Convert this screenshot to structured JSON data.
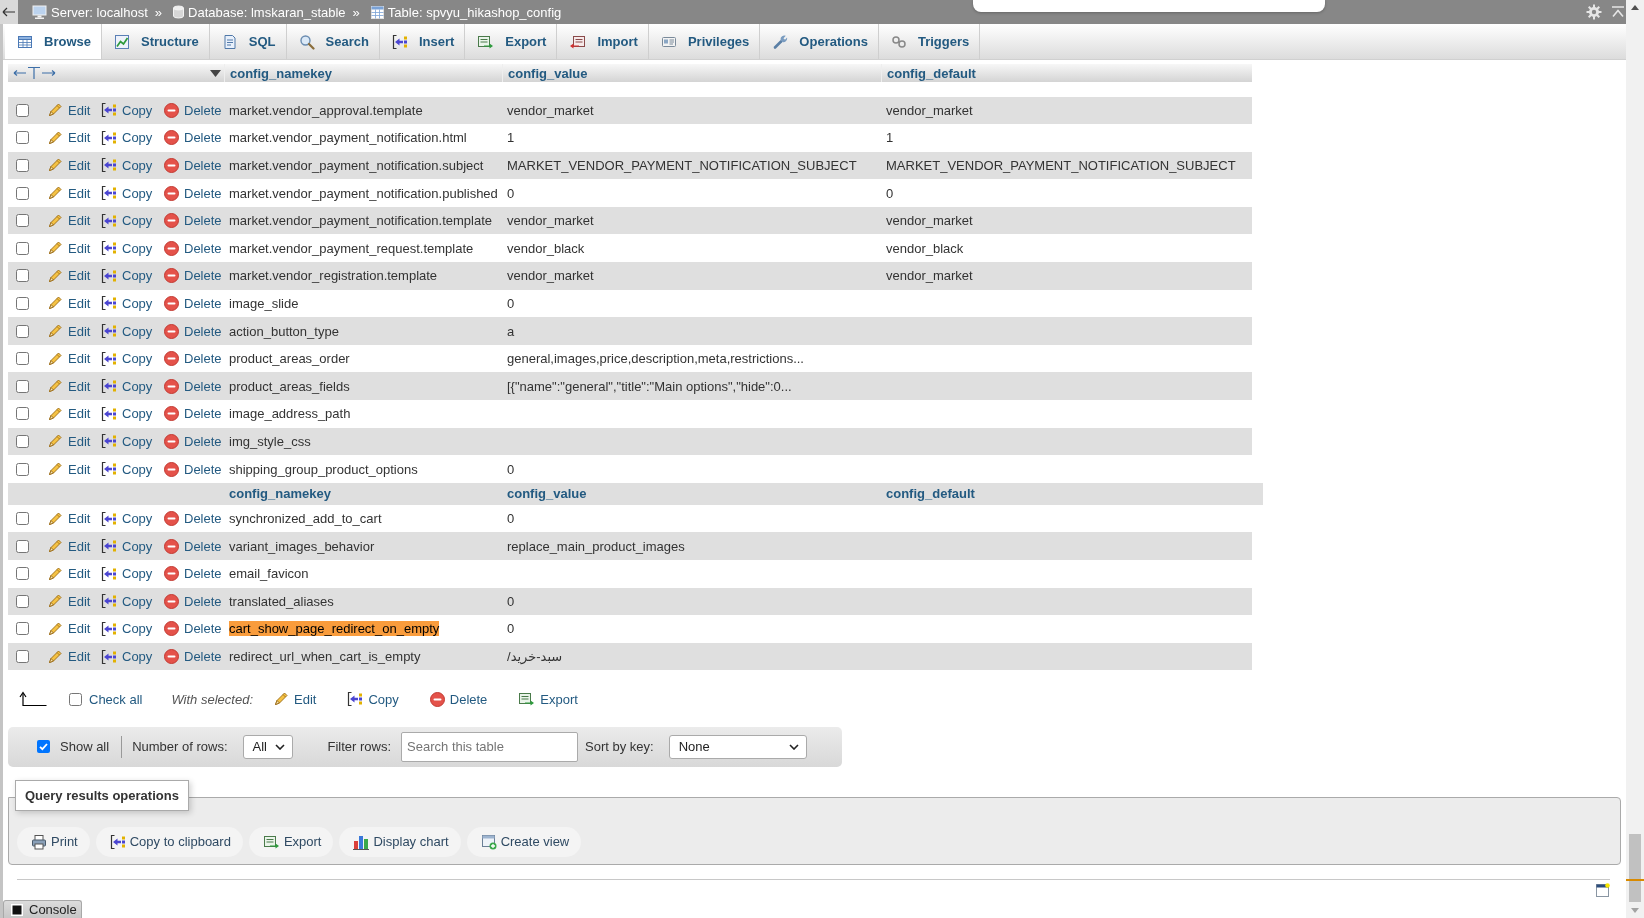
{
  "top_bar": {
    "breadcrumbs": [
      {
        "kind": "server",
        "label": "Server: localhost"
      },
      {
        "kind": "separator",
        "label": "»"
      },
      {
        "kind": "database",
        "label": "Database: lmskaran_stable"
      },
      {
        "kind": "separator",
        "label": "»"
      },
      {
        "kind": "table",
        "label": "Table: spvyu_hikashop_config"
      }
    ]
  },
  "tabs": [
    {
      "kind": "browse",
      "label": "Browse",
      "selected": true
    },
    {
      "kind": "structure",
      "label": "Structure",
      "selected": false
    },
    {
      "kind": "sql",
      "label": "SQL",
      "selected": false
    },
    {
      "kind": "search",
      "label": "Search",
      "selected": false
    },
    {
      "kind": "insert",
      "label": "Insert",
      "selected": false
    },
    {
      "kind": "export",
      "label": "Export",
      "selected": false
    },
    {
      "kind": "import",
      "label": "Import",
      "selected": false
    },
    {
      "kind": "privileges",
      "label": "Privileges",
      "selected": false
    },
    {
      "kind": "operations",
      "label": "Operations",
      "selected": false
    },
    {
      "kind": "triggers",
      "label": "Triggers",
      "selected": false
    }
  ],
  "table": {
    "rows": [
      {
        "kind": "sticky_header",
        "columns": [
          "config_namekey",
          "config_value",
          "config_default"
        ]
      },
      {
        "kind": "data",
        "checked": false,
        "edit": "Edit",
        "copy": "Copy",
        "delete": "Delete",
        "config_namekey": "market.vendor_approval.template",
        "highlighted": false,
        "config_value": "vendor_market",
        "config_default": "vendor_market"
      },
      {
        "kind": "data",
        "checked": false,
        "edit": "Edit",
        "copy": "Copy",
        "delete": "Delete",
        "config_namekey": "market.vendor_payment_notification.html",
        "highlighted": false,
        "config_value": "1",
        "config_default": "1"
      },
      {
        "kind": "data",
        "checked": false,
        "edit": "Edit",
        "copy": "Copy",
        "delete": "Delete",
        "config_namekey": "market.vendor_payment_notification.subject",
        "highlighted": false,
        "config_value": "MARKET_VENDOR_PAYMENT_NOTIFICATION_SUBJECT",
        "config_default": "MARKET_VENDOR_PAYMENT_NOTIFICATION_SUBJECT"
      },
      {
        "kind": "data",
        "checked": false,
        "edit": "Edit",
        "copy": "Copy",
        "delete": "Delete",
        "config_namekey": "market.vendor_payment_notification.published",
        "highlighted": false,
        "config_value": "0",
        "config_default": "0"
      },
      {
        "kind": "data",
        "checked": false,
        "edit": "Edit",
        "copy": "Copy",
        "delete": "Delete",
        "config_namekey": "market.vendor_payment_notification.template",
        "highlighted": false,
        "config_value": "vendor_market",
        "config_default": "vendor_market"
      },
      {
        "kind": "data",
        "checked": false,
        "edit": "Edit",
        "copy": "Copy",
        "delete": "Delete",
        "config_namekey": "market.vendor_payment_request.template",
        "highlighted": false,
        "config_value": "vendor_black",
        "config_default": "vendor_black"
      },
      {
        "kind": "data",
        "checked": false,
        "edit": "Edit",
        "copy": "Copy",
        "delete": "Delete",
        "config_namekey": "market.vendor_registration.template",
        "highlighted": false,
        "config_value": "vendor_market",
        "config_default": "vendor_market"
      },
      {
        "kind": "data",
        "checked": false,
        "edit": "Edit",
        "copy": "Copy",
        "delete": "Delete",
        "config_namekey": "image_slide",
        "highlighted": false,
        "config_value": "0"
      },
      {
        "kind": "data",
        "checked": false,
        "edit": "Edit",
        "copy": "Copy",
        "delete": "Delete",
        "config_namekey": "action_button_type",
        "highlighted": false,
        "config_value": "a"
      },
      {
        "kind": "data",
        "checked": false,
        "edit": "Edit",
        "copy": "Copy",
        "delete": "Delete",
        "config_namekey": "product_areas_order",
        "highlighted": false,
        "config_value": "general,images,price,description,meta,restrictions..."
      },
      {
        "kind": "data",
        "checked": false,
        "edit": "Edit",
        "copy": "Copy",
        "delete": "Delete",
        "config_namekey": "product_areas_fields",
        "highlighted": false,
        "config_value": "[{\"name\":\"general\",\"title\":\"Main options\",\"hide\":0..."
      },
      {
        "kind": "data",
        "checked": false,
        "edit": "Edit",
        "copy": "Copy",
        "delete": "Delete",
        "config_namekey": "image_address_path",
        "highlighted": false
      },
      {
        "kind": "data",
        "checked": false,
        "edit": "Edit",
        "copy": "Copy",
        "delete": "Delete",
        "config_namekey": "img_style_css",
        "highlighted": false
      },
      {
        "kind": "data",
        "checked": false,
        "edit": "Edit",
        "copy": "Copy",
        "delete": "Delete",
        "config_namekey": "shipping_group_product_options",
        "highlighted": false,
        "config_value": "0"
      },
      {
        "kind": "header",
        "columns": [
          "config_namekey",
          "config_value",
          "config_default"
        ]
      },
      {
        "kind": "data",
        "checked": false,
        "edit": "Edit",
        "copy": "Copy",
        "delete": "Delete",
        "config_namekey": "synchronized_add_to_cart",
        "highlighted": false,
        "config_value": "0"
      },
      {
        "kind": "data",
        "checked": false,
        "edit": "Edit",
        "copy": "Copy",
        "delete": "Delete",
        "config_namekey": "variant_images_behavior",
        "highlighted": false,
        "config_value": "replace_main_product_images"
      },
      {
        "kind": "data",
        "checked": false,
        "edit": "Edit",
        "copy": "Copy",
        "delete": "Delete",
        "config_namekey": "email_favicon",
        "highlighted": false
      },
      {
        "kind": "data",
        "checked": false,
        "edit": "Edit",
        "copy": "Copy",
        "delete": "Delete",
        "config_namekey": "translated_aliases",
        "highlighted": false,
        "config_value": "0"
      },
      {
        "kind": "data",
        "checked": false,
        "edit": "Edit",
        "copy": "Copy",
        "delete": "Delete",
        "config_namekey": "cart_show_page_redirect_on_empty",
        "highlighted": true,
        "config_value": "0"
      },
      {
        "kind": "data",
        "checked": false,
        "edit": "Edit",
        "copy": "Copy",
        "delete": "Delete",
        "config_namekey": "redirect_url_when_cart_is_empty",
        "highlighted": false,
        "config_value": "/سبد-خرید"
      }
    ]
  },
  "bulk_actions": {
    "check_all": {
      "label": "Check all",
      "checked": false
    },
    "with_selected": "With selected:",
    "actions": [
      {
        "kind": "edit",
        "label": "Edit"
      },
      {
        "kind": "copy",
        "label": "Copy"
      },
      {
        "kind": "delete",
        "label": "Delete"
      },
      {
        "kind": "export",
        "label": "Export"
      }
    ]
  },
  "navigation": {
    "show_all": {
      "label": "Show all",
      "checked": true
    },
    "rows_label": "Number of rows:",
    "rows_value": "All",
    "filter_label": "Filter rows:",
    "filter_placeholder": "Search this table",
    "sort_label": "Sort by key:",
    "sort_value": "None"
  },
  "query_operations": {
    "legend": "Query results operations",
    "actions": [
      {
        "kind": "print",
        "label": "Print"
      },
      {
        "kind": "copy",
        "label": "Copy to clipboard"
      },
      {
        "kind": "export",
        "label": "Export"
      },
      {
        "kind": "chart",
        "label": "Display chart"
      },
      {
        "kind": "view",
        "label": "Create view"
      }
    ]
  },
  "console": {
    "label": "Console"
  }
}
